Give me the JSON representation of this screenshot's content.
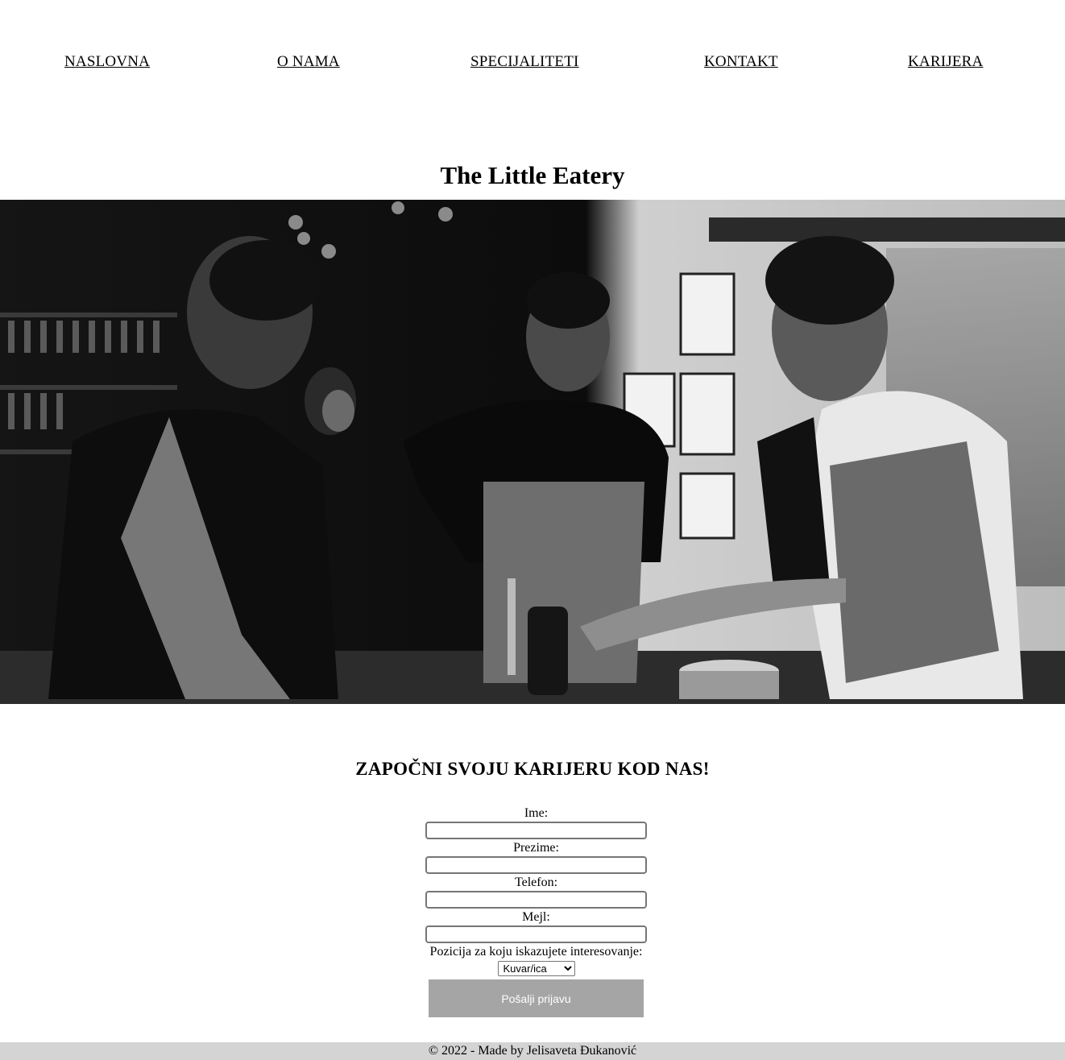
{
  "nav": {
    "items": [
      {
        "label": "NASLOVNA"
      },
      {
        "label": "O NAMA"
      },
      {
        "label": "SPECIJALITETI"
      },
      {
        "label": "KONTAKT"
      },
      {
        "label": "KARIJERA"
      }
    ]
  },
  "header": {
    "title": "The Little Eatery"
  },
  "hero": {
    "image_desc_icon": "kitchen-staff-photo"
  },
  "career": {
    "heading": "ZAPOČNI SVOJU KARIJERU KOD NAS!"
  },
  "form": {
    "first_name_label": "Ime:",
    "first_name_value": "",
    "last_name_label": "Prezime:",
    "last_name_value": "",
    "phone_label": "Telefon:",
    "phone_value": "",
    "email_label": "Mejl:",
    "email_value": "",
    "position_label": "Pozicija za koju iskazujete interesovanje:",
    "position_selected": "Kuvar/ica",
    "submit_label": "Pošalji prijavu",
    "button_color": "#a5a5a5"
  },
  "footer": {
    "text": "© 2022 - Made by Jelisaveta Đukanović",
    "background": "#d4d4d4"
  }
}
